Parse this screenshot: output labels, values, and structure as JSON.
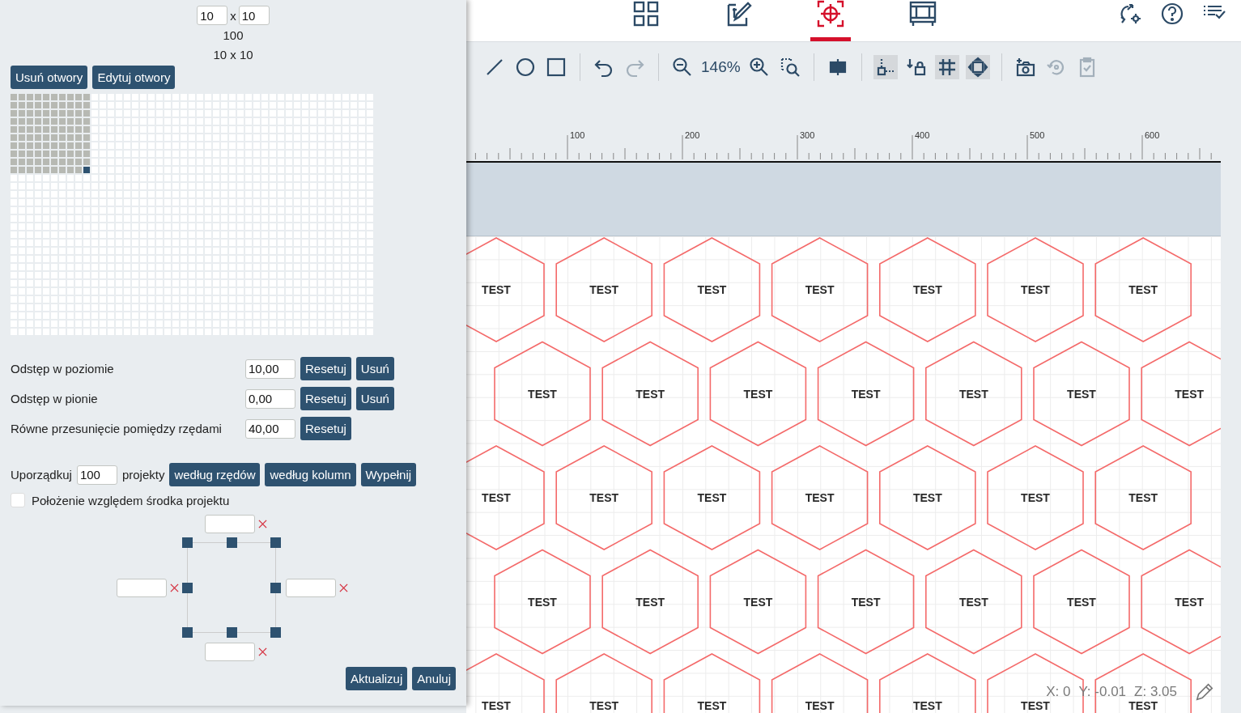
{
  "holes": {
    "columns_input": "10",
    "rows_input": "10",
    "separator": "x",
    "count": "100",
    "size": "10 x 10",
    "buttons": [
      "Usuń otwory",
      "Edytuj otwory"
    ]
  },
  "spacing": [
    {
      "label": "Odstęp w poziomie",
      "value": "10,00",
      "buttons": [
        "Resetuj",
        "Usuń"
      ]
    },
    {
      "label": "Odstęp w pionie",
      "value": "0,00",
      "buttons": [
        "Resetuj",
        "Usuń"
      ]
    },
    {
      "label": "Równe przesunięcie pomiędzy rzędami",
      "value": "40,00",
      "buttons": [
        "Resetuj"
      ]
    }
  ],
  "arrange": {
    "label_before": "Uporządkuj",
    "value": "100",
    "label_after": "projekty",
    "buttons": [
      "według rzędów",
      "według kolumn",
      "Wypełnij"
    ]
  },
  "center_option": {
    "label": "Położenie względem środka projektu",
    "checked": false
  },
  "position_fields": [
    {
      "kind": "top"
    },
    {
      "kind": "left"
    },
    {
      "kind": "right"
    },
    {
      "kind": "bottom"
    }
  ],
  "footer_buttons": [
    "Aktualizuj",
    "Anuluj"
  ],
  "nav_tabs": [
    {
      "kind": "grid",
      "selected": false
    },
    {
      "kind": "edit",
      "selected": false
    },
    {
      "kind": "target",
      "selected": true
    },
    {
      "kind": "frame",
      "selected": false
    }
  ],
  "top_actions": [
    {
      "kind": "sync-settings"
    },
    {
      "kind": "help"
    },
    {
      "kind": "checklist"
    }
  ],
  "toolbar": [
    [
      {
        "kind": "line",
        "on": false,
        "disabled": false
      },
      {
        "kind": "circle",
        "on": false,
        "disabled": false
      },
      {
        "kind": "rectangle",
        "on": false,
        "disabled": false
      }
    ],
    [
      {
        "kind": "undo",
        "on": false,
        "disabled": false
      },
      {
        "kind": "redo",
        "on": false,
        "disabled": true
      }
    ],
    [
      {
        "kind": "zoom-out",
        "on": false,
        "disabled": false
      },
      {
        "kind": "zoom-level",
        "text": "146%"
      },
      {
        "kind": "zoom-in",
        "on": false,
        "disabled": false
      },
      {
        "kind": "zoom-area",
        "on": false,
        "disabled": false
      }
    ],
    [
      {
        "kind": "align",
        "on": false,
        "disabled": false
      }
    ],
    [
      {
        "kind": "snap",
        "on": true,
        "disabled": false
      },
      {
        "kind": "lock",
        "on": false,
        "disabled": false
      },
      {
        "kind": "grid",
        "on": true,
        "disabled": false
      },
      {
        "kind": "fit",
        "on": true,
        "disabled": false
      }
    ],
    [
      {
        "kind": "camera",
        "on": false,
        "disabled": false
      },
      {
        "kind": "history",
        "on": false,
        "disabled": true
      },
      {
        "kind": "clipboard",
        "on": false,
        "disabled": true
      }
    ]
  ],
  "ruler": {
    "labels": [
      "100",
      "200",
      "300",
      "400",
      "500",
      "600"
    ]
  },
  "canvas": {
    "rows": [
      [
        "TEST",
        "TEST",
        "TEST",
        "TEST",
        "TEST",
        "TEST",
        "TEST"
      ],
      [
        "TEST",
        "TEST",
        "TEST",
        "TEST",
        "TEST",
        "TEST",
        "TEST"
      ],
      [
        "TEST",
        "TEST",
        "TEST",
        "TEST",
        "TEST",
        "TEST",
        "TEST"
      ],
      [
        "TEST",
        "TEST",
        "TEST",
        "TEST",
        "TEST",
        "TEST",
        "TEST"
      ],
      [
        "TEST",
        "TEST",
        "TEST",
        "TEST",
        "TEST",
        "TEST",
        "TEST"
      ]
    ]
  },
  "status": {
    "x": "X: 0",
    "y": "Y: -0.01",
    "z": "Z: 3.05"
  }
}
